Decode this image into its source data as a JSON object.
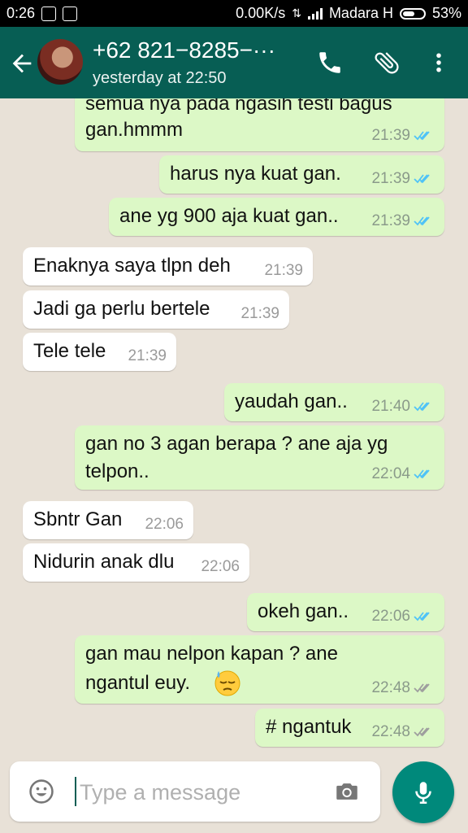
{
  "status_bar": {
    "time": "0:26",
    "network_speed": "0.00K/s",
    "carrier": "Madara H",
    "battery": "53%"
  },
  "header": {
    "contact": "+62 821−8285−···",
    "last_seen": "yesterday at 22:50",
    "icons": [
      "back-arrow-icon",
      "phone-icon",
      "paperclip-icon",
      "more-vert-icon"
    ]
  },
  "messages": [
    {
      "dir": "out",
      "lines": [
        "semua nya pada ngasih testi bagus",
        "gan.hmmm"
      ],
      "time": "21:39",
      "ticks": "read"
    },
    {
      "dir": "out",
      "lines": [
        "harus nya kuat gan."
      ],
      "time": "21:39",
      "ticks": "read"
    },
    {
      "dir": "out",
      "lines": [
        "ane yg 900 aja kuat gan.."
      ],
      "time": "21:39",
      "ticks": "read"
    },
    {
      "dir": "in",
      "lines": [
        "Enaknya saya tlpn deh"
      ],
      "time": "21:39"
    },
    {
      "dir": "in",
      "lines": [
        "Jadi ga perlu bertele"
      ],
      "time": "21:39"
    },
    {
      "dir": "in",
      "lines": [
        "Tele tele"
      ],
      "time": "21:39"
    },
    {
      "dir": "out",
      "lines": [
        "yaudah gan.."
      ],
      "time": "21:40",
      "ticks": "read"
    },
    {
      "dir": "out",
      "lines": [
        "gan no 3 agan berapa ? ane aja yg",
        "telpon.."
      ],
      "time": "22:04",
      "ticks": "read"
    },
    {
      "dir": "in",
      "lines": [
        "Sbntr Gan"
      ],
      "time": "22:06"
    },
    {
      "dir": "in",
      "lines": [
        "Nidurin anak dlu"
      ],
      "time": "22:06"
    },
    {
      "dir": "out",
      "lines": [
        "okeh gan.."
      ],
      "time": "22:06",
      "ticks": "read"
    },
    {
      "dir": "out",
      "lines": [
        "gan mau nelpon kapan ? ane",
        "ngantul euy."
      ],
      "time": "22:48",
      "ticks": "delivered",
      "emoji": "sleepy-face-emoji"
    },
    {
      "dir": "out",
      "lines": [
        "# ngantuk"
      ],
      "time": "22:48",
      "ticks": "delivered"
    }
  ],
  "composer": {
    "placeholder": "Type a message",
    "icons": [
      "emoji-icon",
      "camera-icon",
      "mic-icon"
    ]
  },
  "colors": {
    "header": "#075e54",
    "outgoing_bubble": "#dcf8c6",
    "incoming_bubble": "#ffffff",
    "read_ticks": "#4fc3f7",
    "delivered_ticks": "#9e9e9e",
    "mic_button": "#00897b"
  }
}
